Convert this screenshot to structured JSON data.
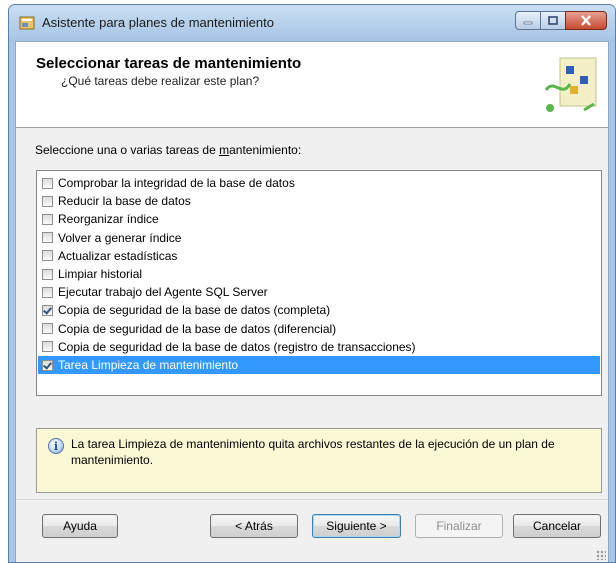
{
  "window": {
    "title": "Asistente para planes de mantenimiento",
    "icon": "wizard-icon",
    "controls": [
      "minimize-icon",
      "maximize-icon",
      "close-icon"
    ]
  },
  "header": {
    "title": "Seleccionar tareas de mantenimiento",
    "subtitle": "¿Qué tareas debe realizar este plan?"
  },
  "prompt": {
    "before": "Seleccione una o varias tareas de ",
    "access_key": "m",
    "after": "antenimiento:"
  },
  "tasks": [
    {
      "label": "Comprobar la integridad de la base de datos",
      "checked": false,
      "selected": false
    },
    {
      "label": "Reducir la base de datos",
      "checked": false,
      "selected": false
    },
    {
      "label": "Reorganizar índice",
      "checked": false,
      "selected": false
    },
    {
      "label": "Volver a generar índice",
      "checked": false,
      "selected": false
    },
    {
      "label": "Actualizar estadísticas",
      "checked": false,
      "selected": false
    },
    {
      "label": "Limpiar historial",
      "checked": false,
      "selected": false
    },
    {
      "label": "Ejecutar trabajo del Agente SQL Server",
      "checked": false,
      "selected": false
    },
    {
      "label": "Copia de seguridad de la base de datos (completa)",
      "checked": true,
      "selected": false
    },
    {
      "label": "Copia de seguridad de la base de datos (diferencial)",
      "checked": false,
      "selected": false
    },
    {
      "label": "Copia de seguridad de la base de datos (registro de transacciones)",
      "checked": false,
      "selected": false
    },
    {
      "label": "Tarea Limpieza de mantenimiento",
      "checked": true,
      "selected": true
    }
  ],
  "info": {
    "icon": "info-icon",
    "text": "La tarea Limpieza de mantenimiento quita archivos restantes de la ejecución de un plan de mantenimiento."
  },
  "buttons": {
    "help": "Ayuda",
    "back": "< Atrás",
    "next": "Siguiente >",
    "finish": "Finalizar",
    "cancel": "Cancelar"
  },
  "colors": {
    "selection": "#3399ff",
    "info_background": "#fbf8d6",
    "title_bar": "#b9d1ea"
  }
}
